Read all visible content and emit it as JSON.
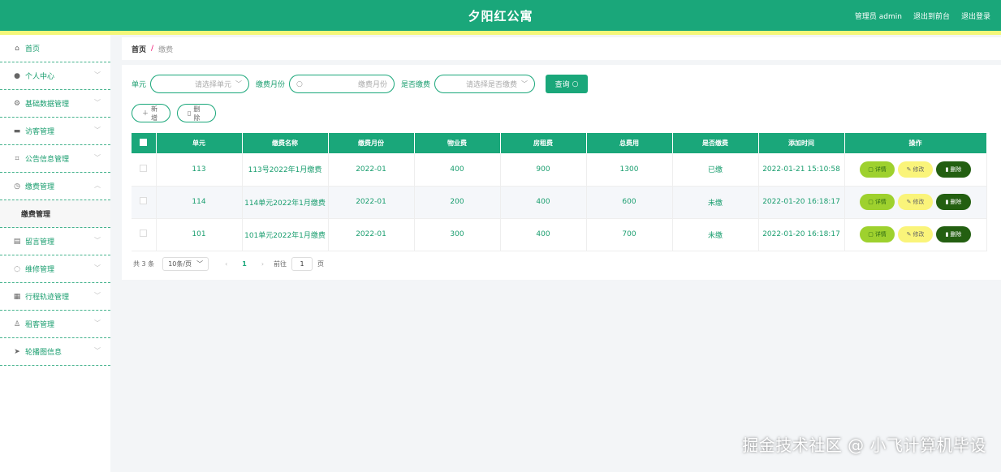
{
  "header": {
    "title": "夕阳红公寓",
    "admin_label": "管理员 admin",
    "back_label": "退出到前台",
    "logout_label": "退出登录"
  },
  "sidebar": {
    "items": [
      {
        "label": "首页",
        "icon": "home-icon"
      },
      {
        "label": "个人中心",
        "icon": "user-icon"
      },
      {
        "label": "基础数据管理",
        "icon": "gear-icon"
      },
      {
        "label": "访客管理",
        "icon": "briefcase-icon"
      },
      {
        "label": "公告信息管理",
        "icon": "crop-icon"
      },
      {
        "label": "缴费管理",
        "icon": "clock-icon"
      },
      {
        "label": "留言管理",
        "icon": "message-icon"
      },
      {
        "label": "维修管理",
        "icon": "power-icon"
      },
      {
        "label": "行程轨迹管理",
        "icon": "grid-icon"
      },
      {
        "label": "租客管理",
        "icon": "person-icon"
      },
      {
        "label": "轮播图信息",
        "icon": "plane-icon"
      }
    ],
    "submenu_label": "缴费管理"
  },
  "breadcrumb": {
    "home": "首页",
    "separator": "/",
    "current": "缴费"
  },
  "search": {
    "unit_label": "单元",
    "unit_placeholder": "请选择单元",
    "month_label": "缴费月份",
    "month_placeholder": "缴费月份",
    "paid_label": "是否缴费",
    "paid_placeholder": "请选择是否缴费",
    "query_label": "查询"
  },
  "actions": {
    "add_label": "新增",
    "delete_label": "删除"
  },
  "table": {
    "headers": [
      "单元",
      "缴费名称",
      "缴费月份",
      "物业费",
      "房租费",
      "总费用",
      "是否缴费",
      "添加时间",
      "操作"
    ],
    "rows": [
      [
        "113",
        "113号2022年1月缴费",
        "2022-01",
        "400",
        "900",
        "1300",
        "已缴",
        "2022-01-21 15:10:58"
      ],
      [
        "114",
        "114单元2022年1月缴费",
        "2022-01",
        "200",
        "400",
        "600",
        "未缴",
        "2022-01-20 16:18:17"
      ],
      [
        "101",
        "101单元2022年1月缴费",
        "2022-01",
        "300",
        "400",
        "700",
        "未缴",
        "2022-01-20 16:18:17"
      ]
    ],
    "op_detail": "详情",
    "op_edit": "修改",
    "op_delete": "删除"
  },
  "pager": {
    "total": "共 3 条",
    "size": "10条/页",
    "current": "1",
    "goto_label": "前往",
    "goto_value": "1",
    "page_suffix": "页"
  },
  "watermark": "掘金技术社区 @ 小飞计算机毕设",
  "colors": {
    "primary": "#1aa77a",
    "header_strip": "#f4f77a",
    "detail_btn": "#9ed12e",
    "edit_btn": "#faf47a",
    "delete_btn": "#235f11"
  }
}
